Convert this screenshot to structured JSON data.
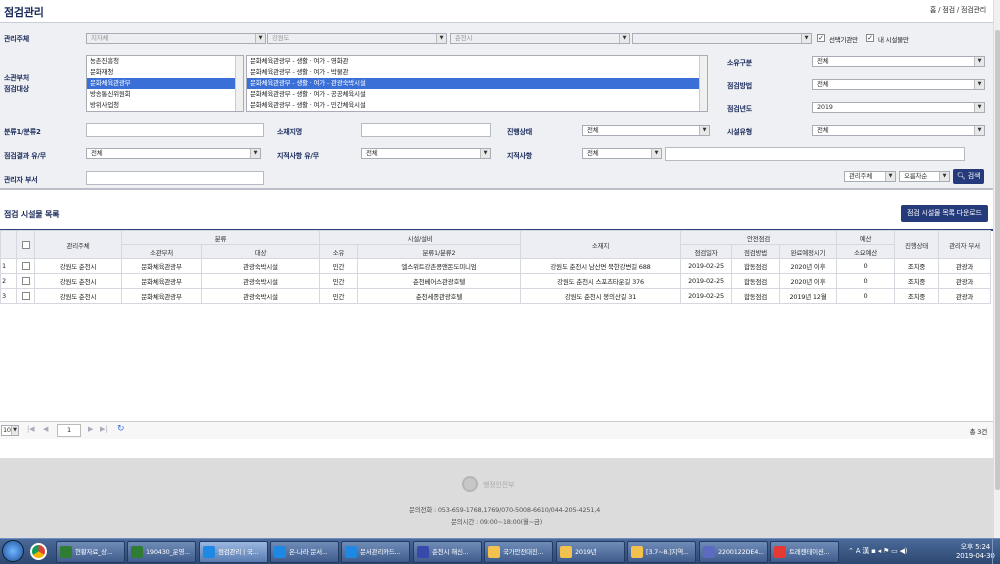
{
  "page": {
    "title": "점검관리",
    "breadcrumb": "홈 / 점검 / 점검관리"
  },
  "filter": {
    "manager_label": "관리주체",
    "manager_selects": [
      "지자체",
      "강원도",
      "춘천시",
      ""
    ],
    "chk_selected_label": "선택기관만",
    "chk_my_label": "내 시설물만",
    "dept_label": "소관부처\n점검대상",
    "dept_list": [
      "농촌진흥청",
      "문화재청",
      "문화체육관광부",
      "방송통신위원회",
      "방위사업청"
    ],
    "dept_selected": 2,
    "target_list": [
      "문화체육관광부 - 생활 · 여가 - 영화관",
      "문화체육관광부 - 생활 · 여가 - 박물관",
      "문화체육관광부 - 생활 · 여가 - 관광숙박시설",
      "문화체육관광부 - 생활 · 여가 - 공공체육시설",
      "문화체육관광부 - 생활 · 여가 - 민간체육시설"
    ],
    "target_selected": 2,
    "own_label": "소유구분",
    "own_value": "전체",
    "method_label": "점검방법",
    "method_value": "전체",
    "year_label": "점검년도",
    "year_value": "2019",
    "cat_label": "분류1/분류2",
    "addr_label": "소재지명",
    "progress_label": "진행상태",
    "progress_value": "전체",
    "facility_type_label": "시설유형",
    "facility_type_value": "전체",
    "result_label": "점검결과 유/무",
    "result_value": "전체",
    "issue_label": "지적사항 유/무",
    "issue_value": "전체",
    "issue_item_label": "지적사항",
    "issue_item_value": "전체",
    "manager_dept_label": "관리자 부서",
    "sort1": "관리주체",
    "sort2": "오름차순",
    "search_button": "검색"
  },
  "list": {
    "title": "점검 시설물 목록",
    "download_button": "점검 시설물 목록 다운로드",
    "group_headers": {
      "cat": "분류",
      "facility": "시설/설비",
      "safety": "안전점검",
      "budget": "예산"
    },
    "headers": {
      "manager": "관리주체",
      "dept": "소관부처",
      "target": "대상",
      "own": "소유",
      "cat12": "분류1/분류2",
      "addr": "소재지",
      "date": "점검일자",
      "method": "점검방법",
      "due": "완료예정시기",
      "budget_need": "소요예산",
      "progress": "진행상태",
      "mgr_dept": "관리자 부서"
    },
    "rows": [
      {
        "no": "1",
        "manager": "강원도 춘천시",
        "dept": "문화체육관광부",
        "target": "관광숙박시설",
        "own": "민간",
        "cat12": "엘스위트강촌콩앤돈도미니엄",
        "addr": "강원도 춘천시 남산면 북한강변길 688",
        "date": "2019-02-25",
        "method": "합동점검",
        "due": "2020년 이후",
        "budget": "0",
        "progress": "조치중",
        "mgr_dept": "관광과"
      },
      {
        "no": "2",
        "manager": "강원도 춘천시",
        "dept": "문화체육관광부",
        "target": "관광숙박시설",
        "own": "민간",
        "cat12": "춘천베어스관광호텔",
        "addr": "강원도 춘천시 스포츠타운길 376",
        "date": "2019-02-25",
        "method": "합동점검",
        "due": "2020년 이후",
        "budget": "0",
        "progress": "조치중",
        "mgr_dept": "관광과"
      },
      {
        "no": "3",
        "manager": "강원도 춘천시",
        "dept": "문화체육관광부",
        "target": "관광숙박시설",
        "own": "민간",
        "cat12": "춘천세종관광호텔",
        "addr": "강원도 춘천시 봉의산길 31",
        "date": "2019-02-25",
        "method": "합동점검",
        "due": "2019년 12월",
        "budget": "0",
        "progress": "조치중",
        "mgr_dept": "관광과"
      }
    ],
    "page_size": "10",
    "page_no": "1",
    "total": "총 3건"
  },
  "footer": {
    "logo": "행정안전부",
    "phone": "문의전화 : 053-659-1768,1769/070-5008-6610/044-205-4251,4",
    "hours": "문의시간 : 09:00~18:00(월~금)"
  },
  "taskbar": {
    "items": [
      "현황자료_상...",
      "190430_운영...",
      "점검관리 | 국...",
      "온-나라 문서...",
      "문서관리카드...",
      "춘천시 해신...",
      "국가안전대진...",
      "2019년",
      "[3.7~8.]지역...",
      "2200122DE4...",
      "트래젠테이션..."
    ],
    "time": "오후 5:24",
    "date": "2019-04-30",
    "colors": {
      "taskbar": "#2d4770",
      "accent": "#243a7a"
    }
  }
}
